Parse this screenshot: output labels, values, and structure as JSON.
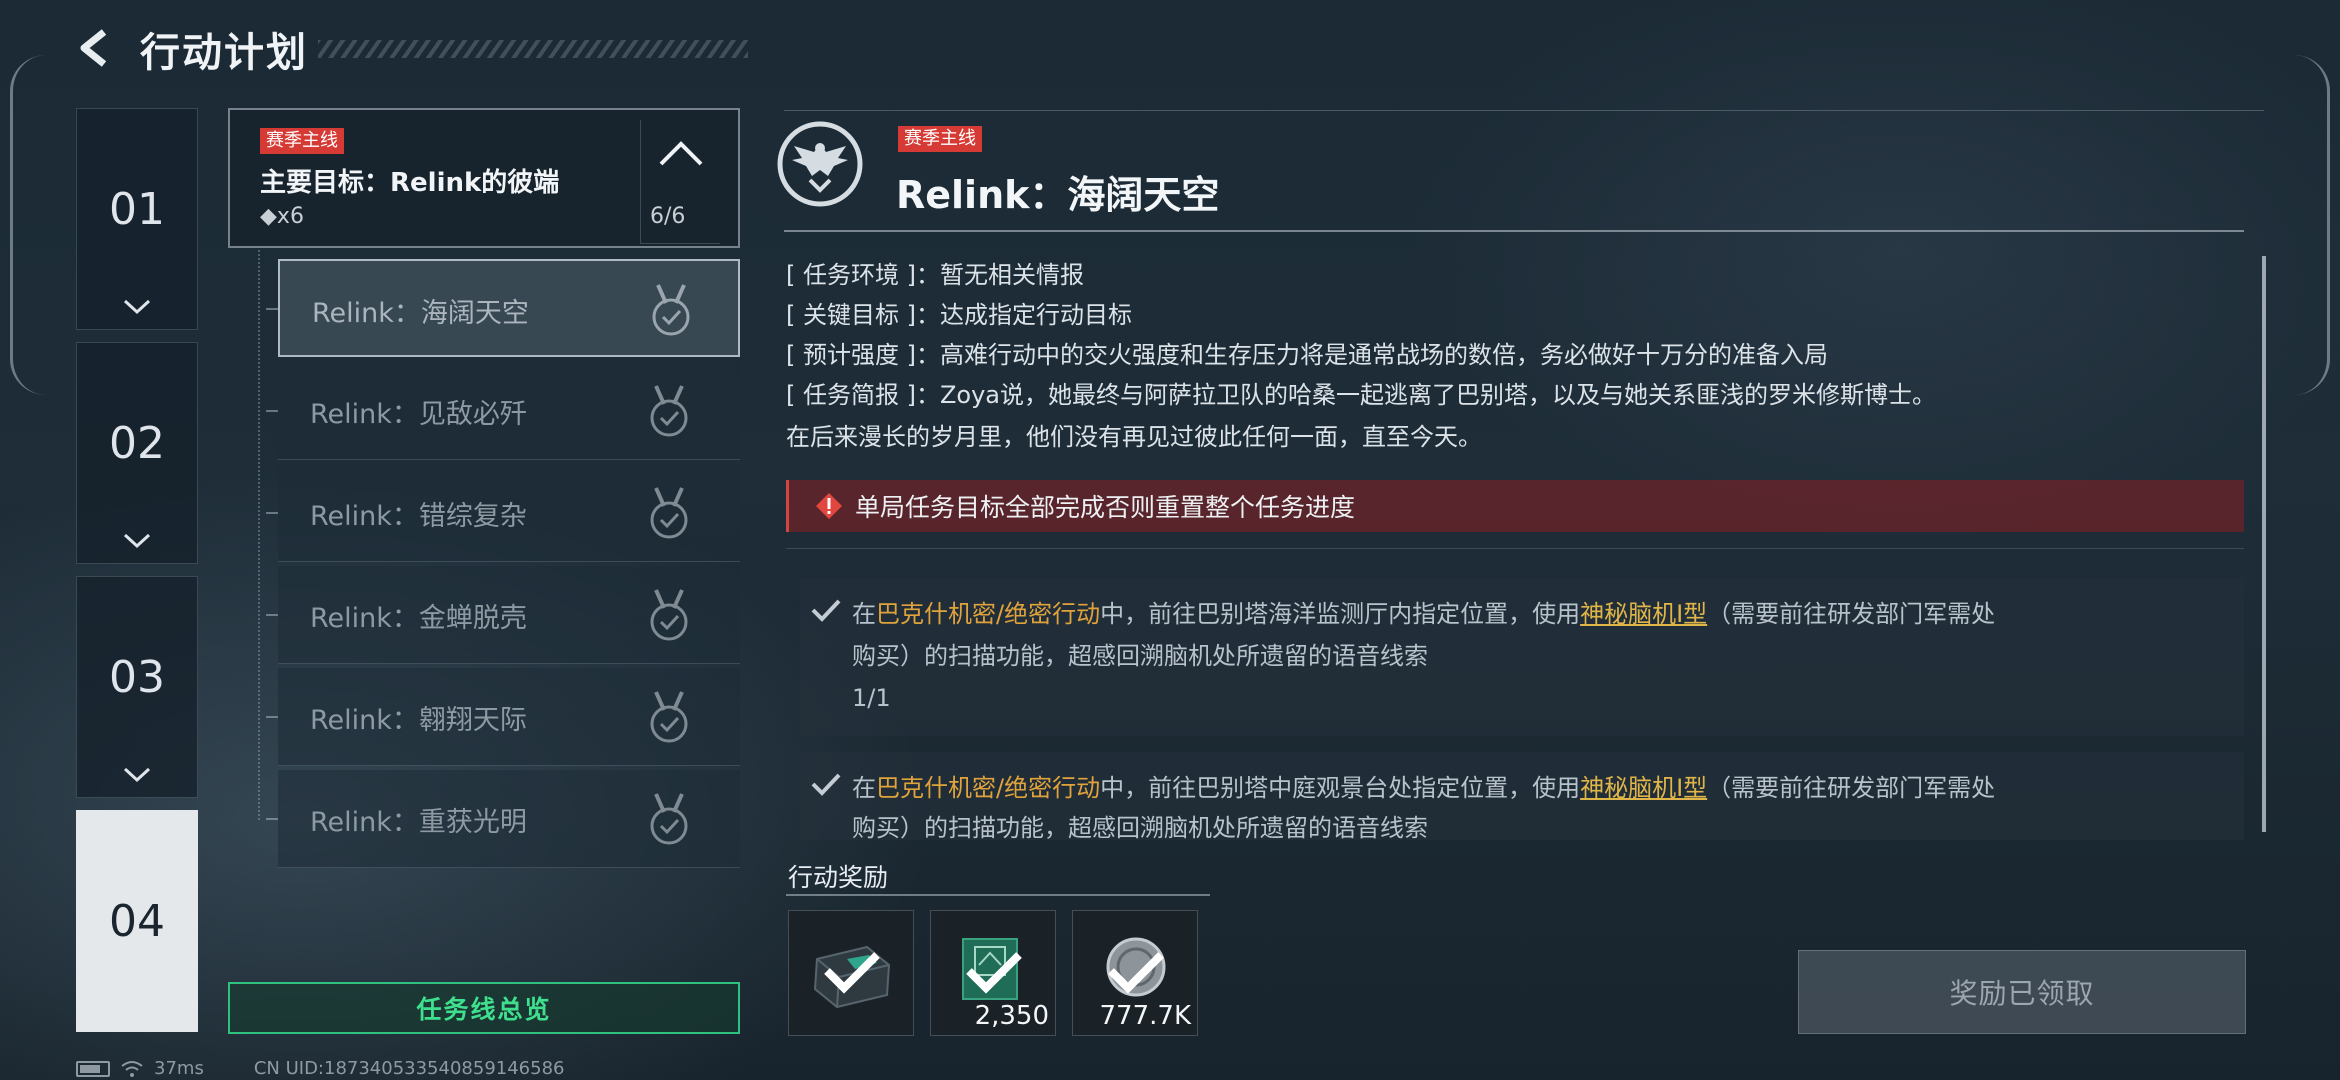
{
  "header": {
    "title": "行动计划"
  },
  "chapters": [
    {
      "label": "01",
      "active": false
    },
    {
      "label": "02",
      "active": false
    },
    {
      "label": "03",
      "active": false
    },
    {
      "label": "04",
      "active": true
    }
  ],
  "objective": {
    "tag": "赛季主线",
    "title": "主要目标：Relink的彼端",
    "diamonds": "◆x6",
    "progress": "6/6"
  },
  "missions": [
    {
      "label": "Relink：海阔天空",
      "selected": true
    },
    {
      "label": "Relink：见敌必歼",
      "selected": false
    },
    {
      "label": "Relink：错综复杂",
      "selected": false
    },
    {
      "label": "Relink：金蝉脱壳",
      "selected": false
    },
    {
      "label": "Relink：翱翔天际",
      "selected": false
    },
    {
      "label": "Relink：重获光明",
      "selected": false
    }
  ],
  "overview_button": "任务线总览",
  "detail": {
    "tag": "赛季主线",
    "title": "Relink：海阔天空",
    "info": [
      "[ 任务环境 ]：暂无相关情报",
      "[ 关键目标 ]：达成指定行动目标",
      "[ 预计强度 ]：高难行动中的交火强度和生存压力将是通常战场的数倍，务必做好十万分的准备入局",
      "[ 任务简报 ]：Zoya说，她最终与阿萨拉卫队的哈桑一起逃离了巴别塔，以及与她关系匪浅的罗米修斯博士。",
      "在后来漫长的岁月里，他们没有再见过彼此任何一面，直至今天。"
    ],
    "warning": "单局任务目标全部完成否则重置整个任务进度",
    "tasks": [
      {
        "pre": "在",
        "mode": "巴克什机密/绝密行动",
        "mid": "中，前往巴别塔海洋监测厅内指定位置，使用",
        "item": "神秘脑机Ⅰ型",
        "post": "（需要前往研发部门军需处",
        "line2": "购买）的扫描功能，超感回溯脑机处所遗留的语音线索",
        "progress": "1/1"
      },
      {
        "pre": "在",
        "mode": "巴克什机密/绝密行动",
        "mid": "中，前往巴别塔中庭观景台处指定位置，使用",
        "item": "神秘脑机Ⅰ型",
        "post": "（需要前往研发部门军需处",
        "line2": "购买）的扫描功能，超感回溯脑机处所遗留的语音线索",
        "progress": ""
      }
    ]
  },
  "rewards": {
    "title": "行动奖励",
    "items": [
      {
        "icon": "armor-crate-icon",
        "qty": ""
      },
      {
        "icon": "currency-card-icon",
        "qty": "2,350"
      },
      {
        "icon": "coin-icon",
        "qty": "777.7K"
      }
    ],
    "claim_button": "奖励已领取"
  },
  "status_bar": {
    "ping": "37ms",
    "uid": "CN UID:18734053354085914658​6"
  },
  "colors": {
    "accent_green": "#3ee08d",
    "tag_red": "#d63a34",
    "highlight_orange": "#e0a33c"
  }
}
